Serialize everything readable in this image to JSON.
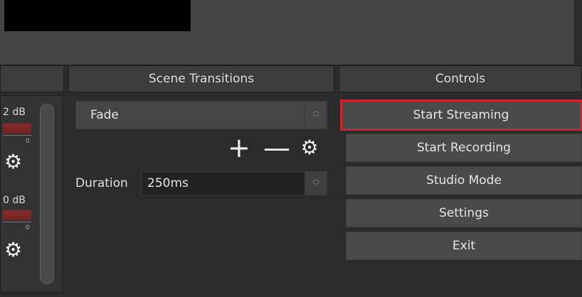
{
  "docks": {
    "mixer": {
      "title": ""
    },
    "transitions": {
      "title": "Scene Transitions"
    },
    "controls": {
      "title": "Controls"
    }
  },
  "mixer": {
    "tracks": [
      {
        "db": "2 dB",
        "zero_mark": "0"
      },
      {
        "db": "0 dB",
        "zero_mark": "0"
      }
    ]
  },
  "transitions": {
    "selected": "Fade",
    "duration_label": "Duration",
    "duration_value": "250ms"
  },
  "controls": {
    "buttons": [
      {
        "label": "Start Streaming",
        "highlighted": true
      },
      {
        "label": "Start Recording"
      },
      {
        "label": "Studio Mode"
      },
      {
        "label": "Settings"
      },
      {
        "label": "Exit"
      }
    ]
  },
  "colors": {
    "background": "#2b2b2b",
    "button": "#4a4a4a",
    "highlight": "#d0202a"
  },
  "icons": {
    "add": "plus-icon",
    "remove": "minus-icon",
    "config": "gear-icon"
  }
}
